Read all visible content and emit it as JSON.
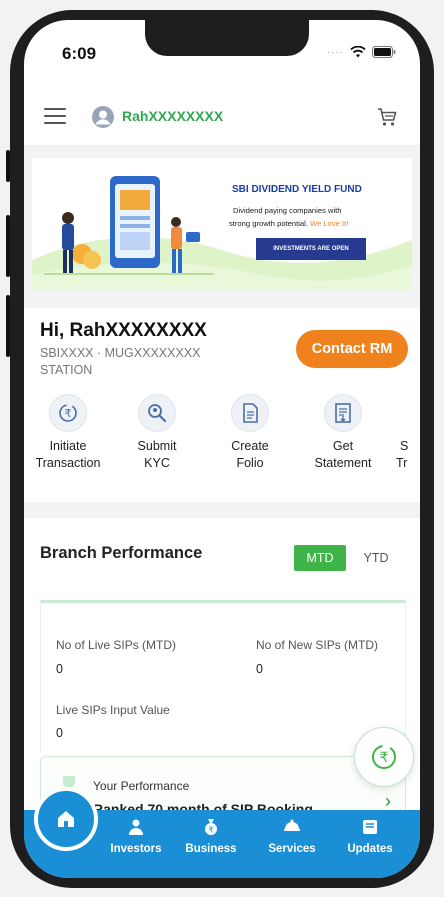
{
  "status": {
    "time": "6:09"
  },
  "header": {
    "username": "RahXXXXXXXX"
  },
  "banner": {
    "title": "SBI DIVIDEND YIELD FUND",
    "line1": "Dividend paying companies with",
    "line2": "strong growth potential.",
    "line2_highlight": "We Love It!",
    "cta": "INVESTMENTS ARE OPEN"
  },
  "greeting": {
    "hi": "Hi, RahXXXXXXXX",
    "code": "SBIXXXX · MUGXXXXXXXX",
    "station": "STATION",
    "contact_button": "Contact RM"
  },
  "quick_actions": [
    {
      "line1": "Initiate",
      "line2": "Transaction",
      "icon": "rupee-cycle-icon"
    },
    {
      "line1": "Submit",
      "line2": "KYC",
      "icon": "search-document-icon"
    },
    {
      "line1": "Create",
      "line2": "Folio",
      "icon": "document-icon"
    },
    {
      "line1": "Get",
      "line2": "Statement",
      "icon": "statement-icon"
    },
    {
      "line1": "S",
      "line2": "Tr",
      "icon": "partial-icon"
    }
  ],
  "branch_performance": {
    "title": "Branch Performance",
    "toggle": {
      "mtd": "MTD",
      "ytd": "YTD",
      "selected": "MTD"
    },
    "metrics": [
      {
        "label": "No of Live SIPs (MTD)",
        "value": "0"
      },
      {
        "label": "No of New SIPs (MTD)",
        "value": "0"
      },
      {
        "label": "Live SIPs Input Value",
        "value": "0"
      }
    ]
  },
  "your_performance": {
    "title": "Your Performance",
    "subtitle": "Ranked 70 month of SIP Booking"
  },
  "bottom_nav": {
    "items": [
      {
        "label": "Investors",
        "icon": "investors-icon"
      },
      {
        "label": "Business",
        "icon": "business-icon"
      },
      {
        "label": "Services",
        "icon": "services-icon"
      },
      {
        "label": "Updates",
        "icon": "updates-icon"
      }
    ],
    "home_icon": "home-icon"
  },
  "colors": {
    "green": "#33a852",
    "orange": "#f0821e",
    "blue": "#1a8fd6",
    "banner_navy": "#263a8f"
  }
}
